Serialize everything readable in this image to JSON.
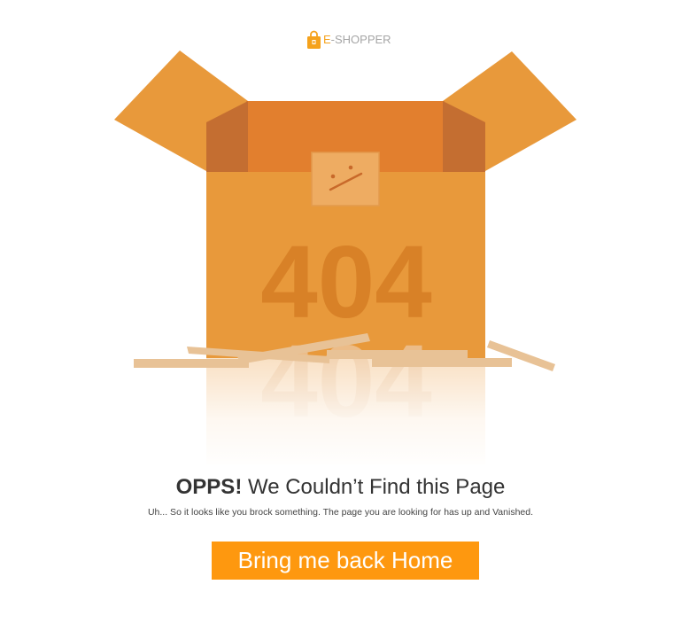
{
  "logo": {
    "icon": "shopping-bag-icon",
    "text_accent": "E",
    "text_rest": "-SHOPPER"
  },
  "illustration": {
    "box_label": "404",
    "reflection_label": "404",
    "face_icon": "sad-face-icon"
  },
  "message": {
    "headline_strong": "OPPS!",
    "headline_rest": " We Couldn’t Find this Page",
    "subtext": "Uh... So it looks like you brock something. The page you are looking for has up and Vanished."
  },
  "button": {
    "label": "Bring me back Home"
  },
  "colors": {
    "brand_orange": "#fe980f",
    "box_body": "#e8993b",
    "box_inner": "#e27f2e",
    "box_shadow": "#c46e31",
    "board": "#e8c296",
    "text_dark": "#333333",
    "logo_gray": "#a6a6a6"
  }
}
